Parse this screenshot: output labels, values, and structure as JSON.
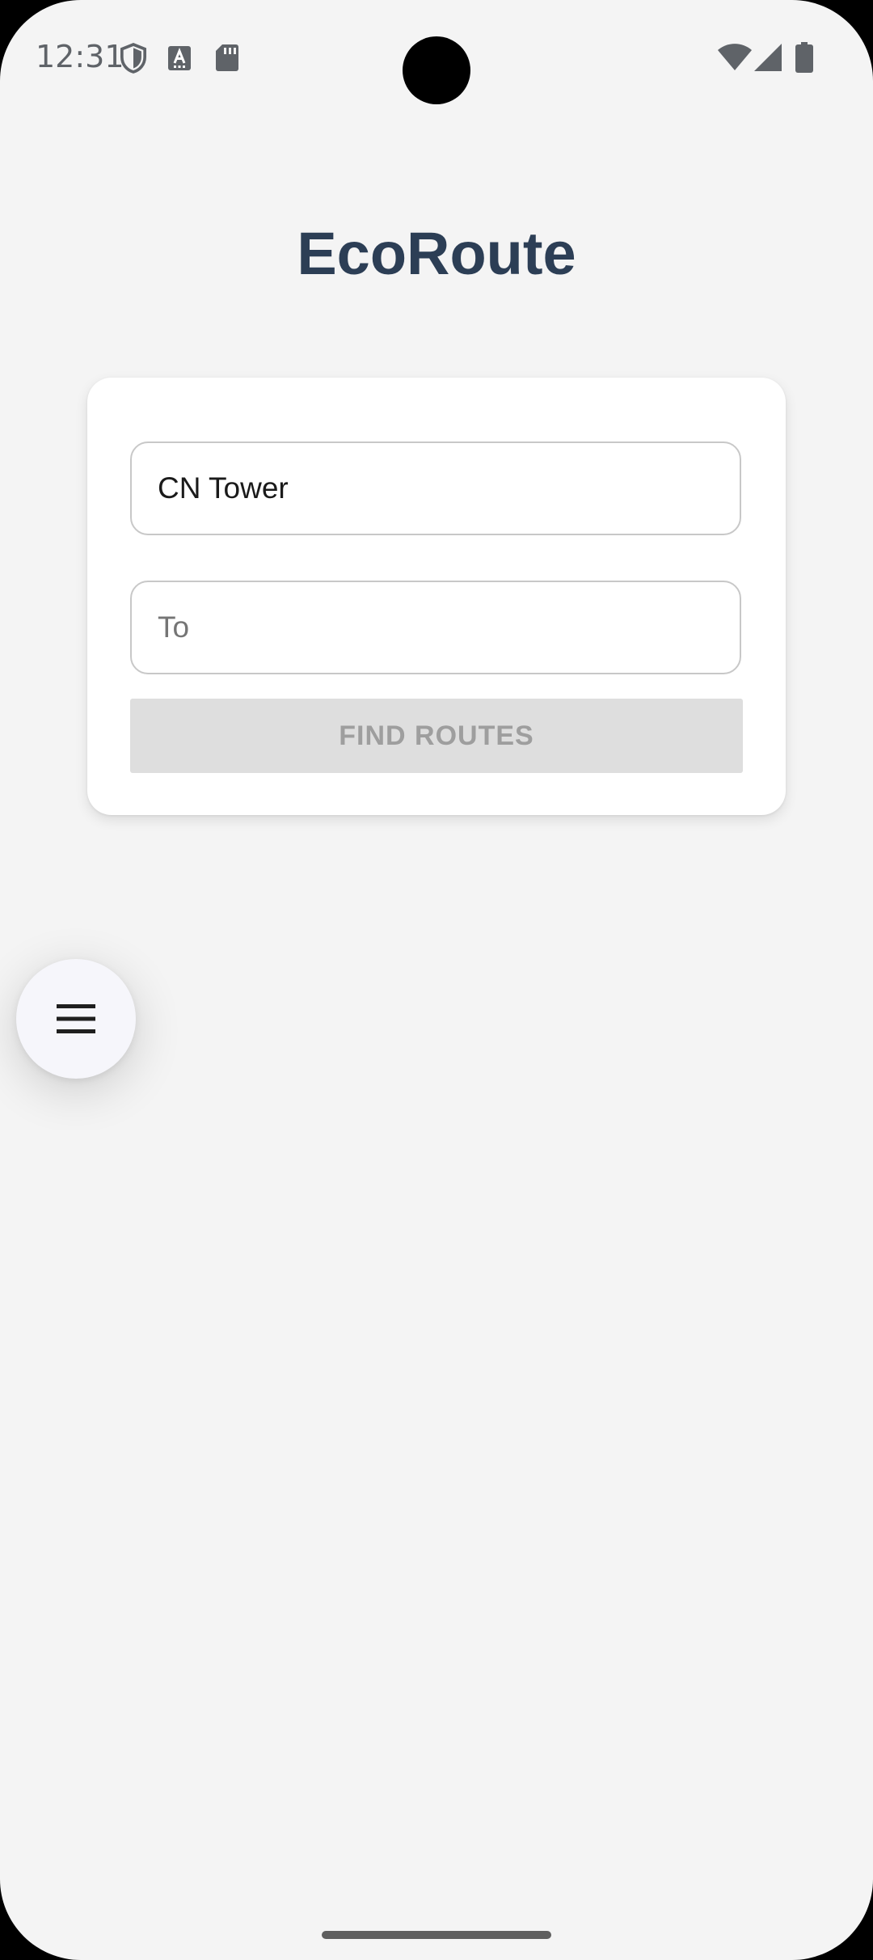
{
  "status_bar": {
    "time": "12:31",
    "left_icons": [
      "shield-icon",
      "font-a-icon",
      "sd-card-icon"
    ],
    "right_icons": [
      "wifi-icon",
      "cellular-signal-icon",
      "battery-icon"
    ]
  },
  "header": {
    "title": "EcoRoute"
  },
  "route_form": {
    "from_value": "CN Tower",
    "to_placeholder": "To",
    "to_value": "",
    "find_button_label": "FIND ROUTES"
  },
  "menu": {
    "icon": "hamburger-menu-icon"
  },
  "colors": {
    "title": "#2c3e55",
    "background": "#f4f4f4",
    "button_disabled_bg": "#dedede",
    "button_disabled_text": "#9e9e9e"
  }
}
